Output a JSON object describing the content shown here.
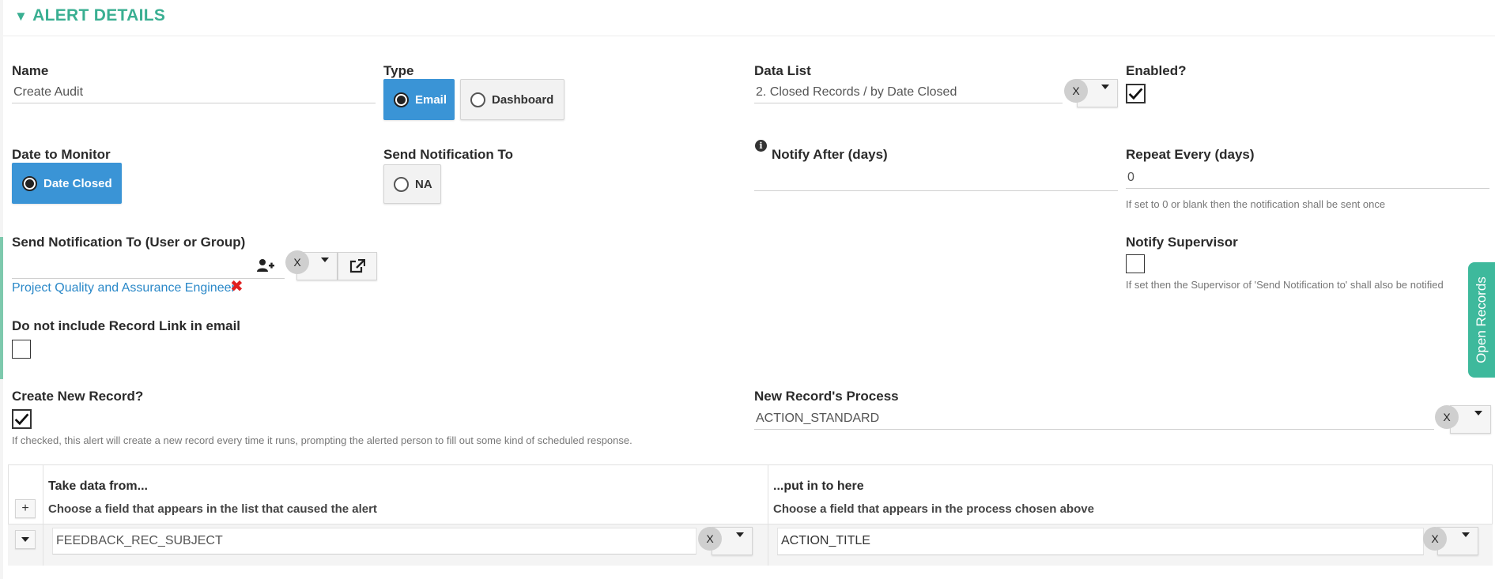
{
  "section": {
    "title": "ALERT DETAILS"
  },
  "name": {
    "label": "Name",
    "value": "Create Audit"
  },
  "type": {
    "label": "Type",
    "options": [
      "Email",
      "Dashboard"
    ],
    "selected": "Email"
  },
  "data_list": {
    "label": "Data List",
    "value": "2. Closed Records / by Date Closed",
    "clear": "X"
  },
  "enabled": {
    "label": "Enabled?",
    "checked": true
  },
  "date_to_monitor": {
    "label": "Date to Monitor",
    "option": "Date Closed",
    "selected": "Date Closed"
  },
  "send_notification_to": {
    "label": "Send Notification To",
    "option": "NA"
  },
  "notify_after": {
    "label": "Notify After (days)",
    "value": ""
  },
  "repeat_every": {
    "label": "Repeat Every (days)",
    "value": "0",
    "help": "If set to 0 or blank then the notification shall be sent once"
  },
  "send_to_user": {
    "label": "Send Notification To (User or Group)",
    "value": "",
    "clear": "X",
    "selected_item": "Project Quality and Assurance Engineer"
  },
  "notify_supervisor": {
    "label": "Notify Supervisor",
    "checked": false,
    "help": "If set then the Supervisor of 'Send Notification to' shall also be notified"
  },
  "no_record_link": {
    "label": "Do not include Record Link in email",
    "checked": false
  },
  "create_new_record": {
    "label": "Create New Record?",
    "checked": true,
    "help": "If checked, this alert will create a new record every time it runs, prompting the alerted person to fill out some kind of scheduled response."
  },
  "new_record_process": {
    "label": "New Record's Process",
    "value": "ACTION_STANDARD",
    "clear": "X"
  },
  "mapping": {
    "add_label": "+",
    "from_header": "Take data from...",
    "from_sub": "Choose a field that appears in the list that caused the alert",
    "to_header": "...put in to here",
    "to_sub": "Choose a field that appears in the process chosen above",
    "rows": [
      {
        "from": "FEEDBACK_REC_SUBJECT",
        "to": "ACTION_TITLE",
        "clear": "X"
      }
    ]
  },
  "side_tab": {
    "label": "Open Records"
  },
  "colors": {
    "accent": "#3aaf92",
    "selected": "#3a94d6",
    "link": "#2a88c8",
    "remove": "#e02020"
  },
  "icons": [
    "add-user-icon",
    "caret-down-icon",
    "external-link-icon",
    "remove-x-icon",
    "info-icon",
    "check-icon"
  ]
}
